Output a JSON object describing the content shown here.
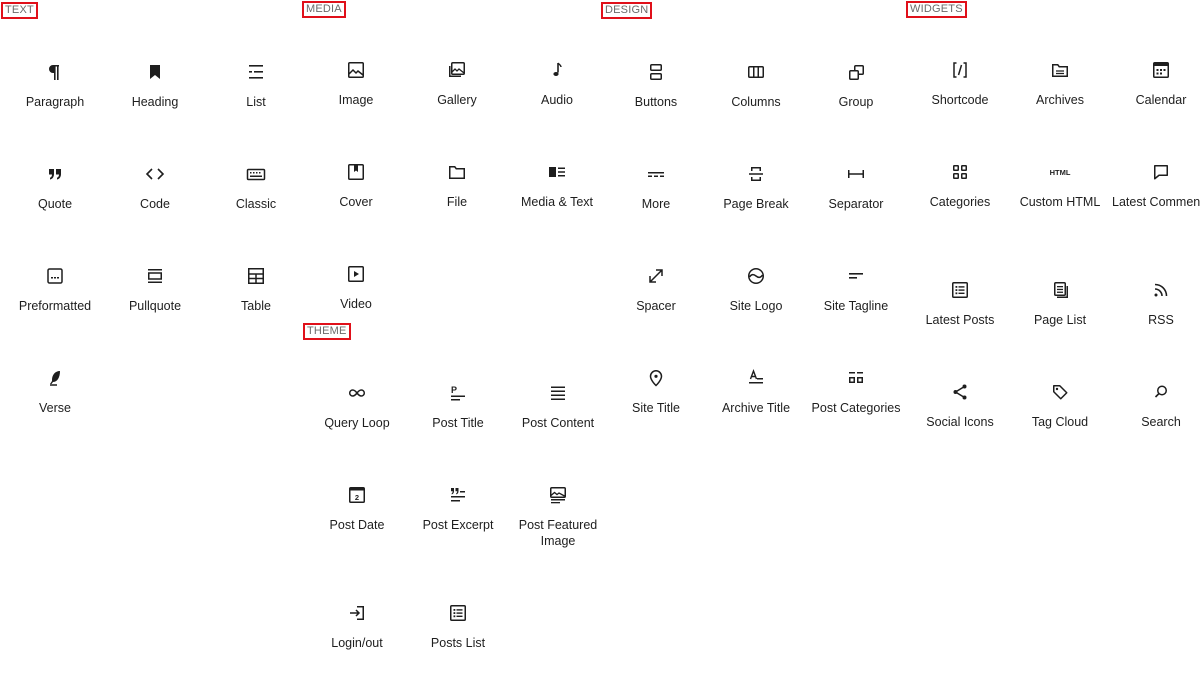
{
  "categories": {
    "text": "TEXT",
    "media": "MEDIA",
    "design": "DESIGN",
    "widgets": "WIDGETS",
    "theme": "THEME"
  },
  "text_blocks": [
    {
      "label": "Paragraph",
      "icon": "paragraph-icon"
    },
    {
      "label": "Heading",
      "icon": "bookmark-icon"
    },
    {
      "label": "List",
      "icon": "list-icon"
    },
    {
      "label": "Quote",
      "icon": "quote-icon"
    },
    {
      "label": "Code",
      "icon": "code-icon"
    },
    {
      "label": "Classic",
      "icon": "keyboard-icon"
    },
    {
      "label": "Preformatted",
      "icon": "preformatted-icon"
    },
    {
      "label": "Pullquote",
      "icon": "pullquote-icon"
    },
    {
      "label": "Table",
      "icon": "table-icon"
    },
    {
      "label": "Verse",
      "icon": "feather-icon"
    }
  ],
  "media_blocks": [
    {
      "label": "Image",
      "icon": "image-icon"
    },
    {
      "label": "Gallery",
      "icon": "gallery-icon"
    },
    {
      "label": "Audio",
      "icon": "music-note-icon"
    },
    {
      "label": "Cover",
      "icon": "cover-icon"
    },
    {
      "label": "File",
      "icon": "folder-icon"
    },
    {
      "label": "Media & Text",
      "icon": "media-text-icon"
    },
    {
      "label": "Video",
      "icon": "video-icon"
    }
  ],
  "design_blocks": [
    {
      "label": "Buttons",
      "icon": "buttons-icon"
    },
    {
      "label": "Columns",
      "icon": "columns-icon"
    },
    {
      "label": "Group",
      "icon": "group-icon"
    },
    {
      "label": "More",
      "icon": "more-icon"
    },
    {
      "label": "Page Break",
      "icon": "page-break-icon"
    },
    {
      "label": "Separator",
      "icon": "separator-icon"
    },
    {
      "label": "Spacer",
      "icon": "spacer-icon"
    },
    {
      "label": "Site Logo",
      "icon": "site-logo-icon"
    },
    {
      "label": "Site Tagline",
      "icon": "tagline-icon"
    },
    {
      "label": "Site Title",
      "icon": "map-marker-icon"
    },
    {
      "label": "Archive Title",
      "icon": "archive-title-icon"
    },
    {
      "label": "Post Categories",
      "icon": "post-categories-icon"
    }
  ],
  "widget_blocks": [
    {
      "label": "Shortcode",
      "icon": "shortcode-icon"
    },
    {
      "label": "Archives",
      "icon": "archives-icon"
    },
    {
      "label": "Calendar",
      "icon": "calendar-icon"
    },
    {
      "label": "Categories",
      "icon": "categories-icon"
    },
    {
      "label": "Custom HTML",
      "icon": "html-icon"
    },
    {
      "label": "Latest Comments",
      "icon": "comment-icon"
    },
    {
      "label": "Latest Posts",
      "icon": "latest-posts-icon"
    },
    {
      "label": "Page List",
      "icon": "page-list-icon"
    },
    {
      "label": "RSS",
      "icon": "rss-icon"
    },
    {
      "label": "Social Icons",
      "icon": "share-icon"
    },
    {
      "label": "Tag Cloud",
      "icon": "tag-icon"
    },
    {
      "label": "Search",
      "icon": "search-icon"
    }
  ],
  "theme_blocks": [
    {
      "label": "Query Loop",
      "icon": "loop-icon"
    },
    {
      "label": "Post Title",
      "icon": "post-title-icon"
    },
    {
      "label": "Post Content",
      "icon": "post-content-icon"
    },
    {
      "label": "Post Date",
      "icon": "post-date-icon"
    },
    {
      "label": "Post Excerpt",
      "icon": "post-excerpt-icon"
    },
    {
      "label": "Post Featured Image",
      "icon": "featured-image-icon"
    },
    {
      "label": "Login/out",
      "icon": "login-icon"
    },
    {
      "label": "Posts List",
      "icon": "posts-list-icon"
    }
  ],
  "html_icon_text": "HTML",
  "post_date_number": "2",
  "post_title_letter": "P"
}
